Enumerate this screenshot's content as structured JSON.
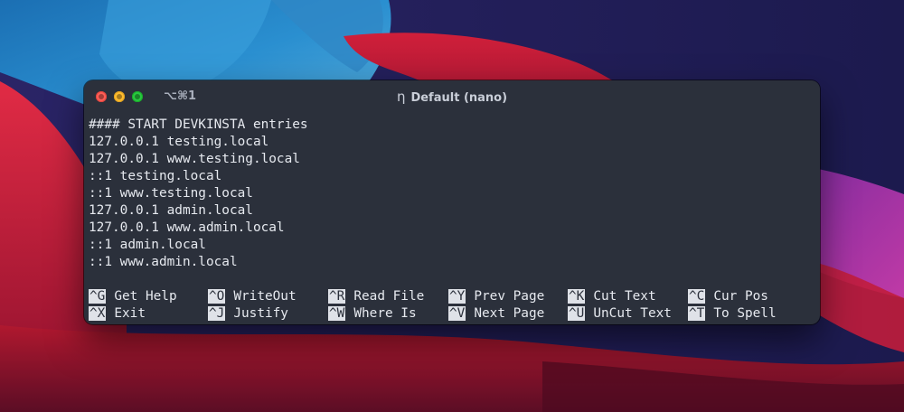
{
  "window": {
    "shortcut": "⌥⌘1",
    "title_icon": "η",
    "title": "Default (nano)"
  },
  "colors": {
    "background": "#2b303b",
    "text": "#e6e9ef",
    "key_highlight": "#dfe2e8",
    "traffic_close": "#ff5f57",
    "traffic_minimize": "#febc2e",
    "traffic_zoom": "#28c840"
  },
  "editor": {
    "lines": [
      "#### START DEVKINSTA entries",
      "127.0.0.1 testing.local",
      "127.0.0.1 www.testing.local",
      "::1 testing.local",
      "::1 www.testing.local",
      "127.0.0.1 admin.local",
      "127.0.0.1 www.admin.local",
      "::1 admin.local",
      "::1 www.admin.local"
    ]
  },
  "shortcuts": {
    "row1": [
      {
        "key": "^G",
        "label": "Get Help"
      },
      {
        "key": "^O",
        "label": "WriteOut"
      },
      {
        "key": "^R",
        "label": "Read File"
      },
      {
        "key": "^Y",
        "label": "Prev Page"
      },
      {
        "key": "^K",
        "label": "Cut Text"
      },
      {
        "key": "^C",
        "label": "Cur Pos"
      }
    ],
    "row2": [
      {
        "key": "^X",
        "label": "Exit"
      },
      {
        "key": "^J",
        "label": "Justify"
      },
      {
        "key": "^W",
        "label": "Where Is"
      },
      {
        "key": "^V",
        "label": "Next Page"
      },
      {
        "key": "^U",
        "label": "UnCut Text"
      },
      {
        "key": "^T",
        "label": "To Spell"
      }
    ]
  }
}
